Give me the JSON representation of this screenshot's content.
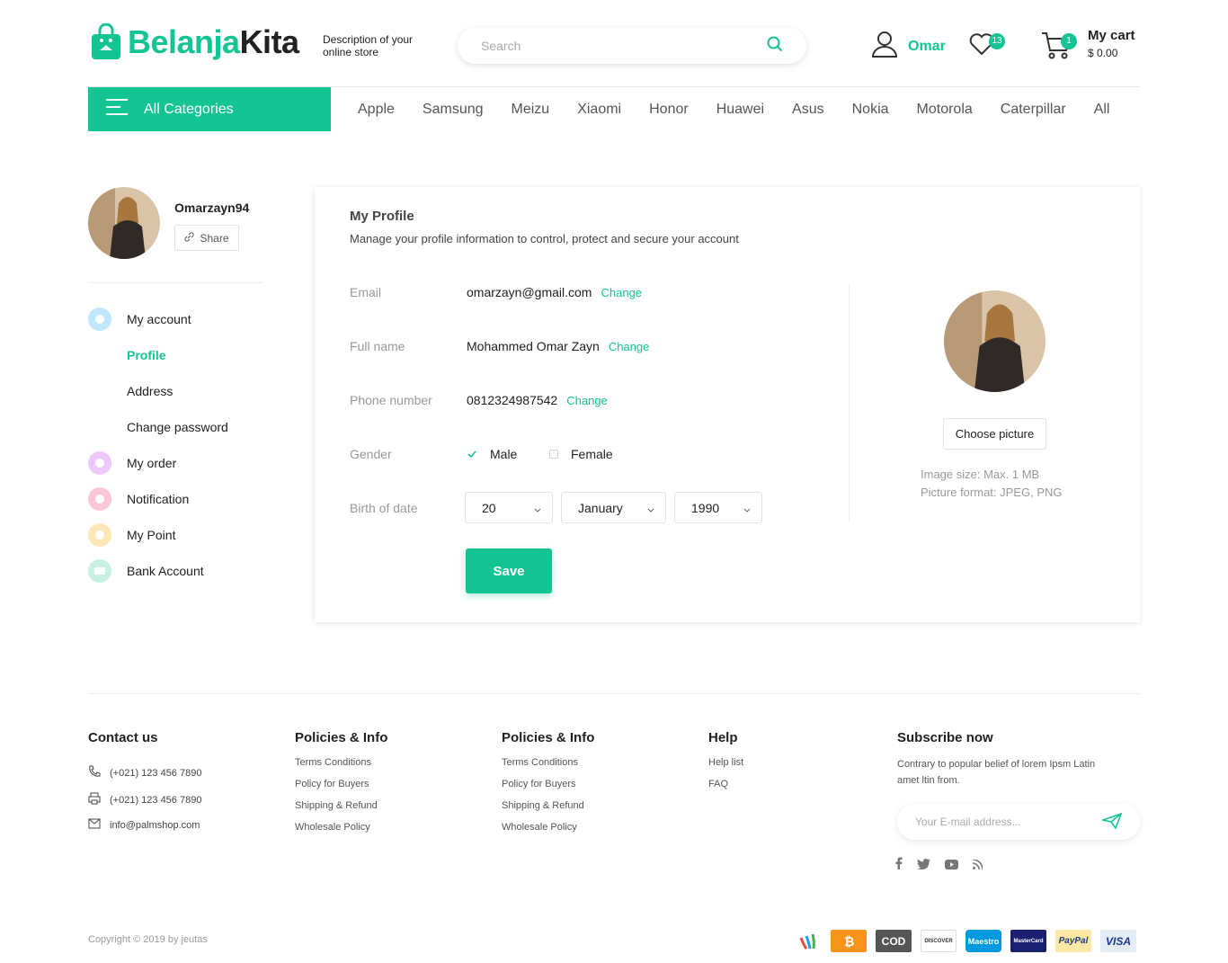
{
  "header": {
    "brand_part1": "Belanja",
    "brand_part2": "Kita",
    "description": "Description of your online store",
    "search_placeholder": "Search",
    "user_name": "Omar",
    "wishlist_count": "13",
    "cart_count": "1",
    "cart_title": "My cart",
    "cart_amount": "$ 0.00"
  },
  "nav": {
    "all_categories": "All Categories",
    "brands": [
      "Apple",
      "Samsung",
      "Meizu",
      "Xiaomi",
      "Honor",
      "Huawei",
      "Asus",
      "Nokia",
      "Motorola",
      "Caterpillar",
      "All"
    ]
  },
  "sidebar": {
    "username": "Omarzayn94",
    "share_label": "Share",
    "menu": [
      {
        "label": "My account",
        "color": "#bfe6fb"
      },
      {
        "label": "My order",
        "color": "#eec8fb"
      },
      {
        "label": "Notification",
        "color": "#fbc6da"
      },
      {
        "label": "My Point",
        "color": "#fde7b6"
      },
      {
        "label": "Bank Account",
        "color": "#c6f1e2"
      }
    ],
    "submenu": [
      "Profile",
      "Address",
      "Change password"
    ]
  },
  "profile": {
    "title": "My Profile",
    "subtitle": "Manage your profile information to control, protect and secure your account",
    "email_label": "Email",
    "email": "omarzayn@gmail.com",
    "fullname_label": "Full name",
    "fullname": "Mohammed Omar Zayn",
    "phone_label": "Phone number",
    "phone": "0812324987542",
    "change_label": "Change",
    "gender_label": "Gender",
    "gender_male": "Male",
    "gender_female": "Female",
    "gender_selected": "Male",
    "birth_label": "Birth of date",
    "birth_day": "20",
    "birth_month": "January",
    "birth_year": "1990",
    "save_label": "Save",
    "choose_picture": "Choose picture",
    "image_size": "Image size: Max. 1 MB",
    "picture_format": "Picture format: JPEG, PNG"
  },
  "footer": {
    "contact_title": "Contact us",
    "phone1": "(+021) 123 456 7890",
    "phone2": "(+021) 123 456 7890",
    "email": "info@palmshop.com",
    "policies_title": "Policies & Info",
    "policies_links": [
      "Terms Conditions",
      "Policy for Buyers",
      "Shipping & Refund",
      "Wholesale Policy"
    ],
    "policies2_title": "Policies & Info",
    "policies2_links": [
      "Terms Conditions",
      "Policy for Buyers",
      "Shipping & Refund",
      "Wholesale Policy"
    ],
    "help_title": "Help",
    "help_links": [
      "Help list",
      "FAQ"
    ],
    "subscribe_title": "Subscribe now",
    "subscribe_desc": "Contrary to popular belief of lorem Ipsm Latin amet ltin from.",
    "subscribe_placeholder": "Your E-mail address...",
    "copyright": "Copyright © 2019 by jeutas",
    "payments": [
      "COD",
      "DISCOVER",
      "Maestro",
      "MasterCard",
      "PayPal",
      "VISA"
    ]
  },
  "colors": {
    "accent": "#14c493"
  }
}
